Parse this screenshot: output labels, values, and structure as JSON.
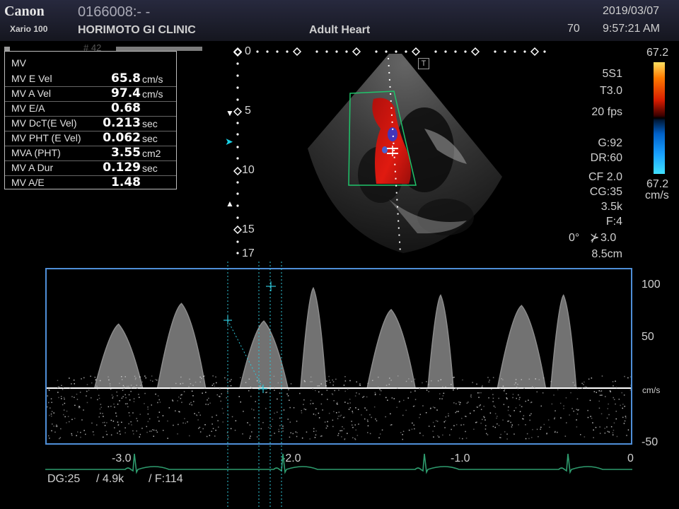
{
  "header": {
    "brand": "Canon",
    "model": "Xario 100",
    "patient_id": "0166008:- -",
    "clinic": "HORIMOTO GI CLINIC",
    "preset": "Adult Heart",
    "date": "2019/03/07",
    "number": "70",
    "time": "9:57:21 AM"
  },
  "mv_panel": {
    "title": "MV",
    "tab": "# 42",
    "rows": [
      {
        "label": "MV E Vel",
        "value": "65.8",
        "unit": "cm/s"
      },
      {
        "label": "MV A Vel",
        "value": "97.4",
        "unit": "cm/s"
      },
      {
        "label": "MV E/A",
        "value": "0.68",
        "unit": ""
      },
      {
        "label": "MV DcT(E Vel)",
        "value": "0.213",
        "unit": "sec"
      },
      {
        "label": "MV PHT (E Vel)",
        "value": "0.062",
        "unit": "sec"
      },
      {
        "label": "MVA (PHT)",
        "value": "3.55",
        "unit": "cm2"
      },
      {
        "label": "MV A Dur",
        "value": "0.129",
        "unit": "sec"
      },
      {
        "label": "MV A/E",
        "value": "1.48",
        "unit": ""
      }
    ]
  },
  "depth_scale": {
    "d0": "0",
    "d5": "5",
    "d10": "10",
    "d15": "15",
    "d17": "17"
  },
  "sector_marker": "T",
  "params": {
    "probe": "5S1",
    "tissue": "T3.0",
    "fps": "20 fps",
    "gain": "G:92",
    "dr": "DR:60",
    "cf": "CF 2.0",
    "cg": "CG:35",
    "prf": "3.5k",
    "filter": "F:4",
    "angle": "0°",
    "angle_val": "3.0",
    "depth": "8.5cm"
  },
  "color_bar": {
    "top": "67.2",
    "bottom": "67.2",
    "unit": "cm/s",
    "top_color": "#ff8800",
    "bottom_color": "#00a8ff"
  },
  "doppler": {
    "vel_labels": {
      "v100": "100",
      "v50": "50",
      "unit": "cm/s",
      "vneg50": "-50"
    },
    "time_labels": {
      "t30": "-3.0",
      "t20": "-2.0",
      "t10": "-1.0",
      "t0": "0"
    },
    "footer": {
      "dg": "DG:25",
      "prf": "/ 4.9k",
      "filter": "/ F:114"
    },
    "peaks_cms": [
      {
        "t": -3.42,
        "v": 62
      },
      {
        "t": -3.0,
        "v": 82
      },
      {
        "t": -2.45,
        "v": 65
      },
      {
        "t": -2.12,
        "v": 97
      },
      {
        "t": -1.6,
        "v": 76
      },
      {
        "t": -1.27,
        "v": 90
      },
      {
        "t": -0.73,
        "v": 80
      },
      {
        "t": -0.45,
        "v": 90
      }
    ],
    "frame_color": "#4f8fd8",
    "ecg_color": "#2e9c6e"
  }
}
